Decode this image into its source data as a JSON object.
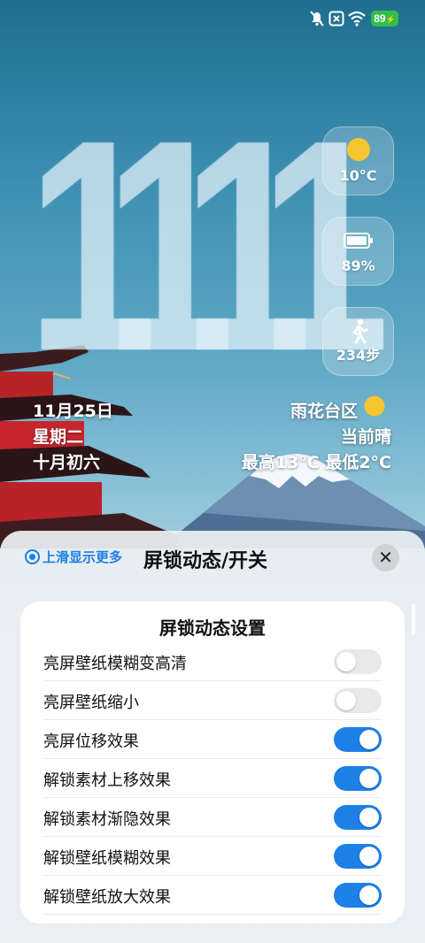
{
  "status_bar": {
    "battery_level": "89",
    "icons": [
      "mute-icon",
      "no-sim-icon",
      "wifi-icon",
      "battery-charging-icon"
    ]
  },
  "clock": {
    "time": "1111"
  },
  "widgets": {
    "weather": {
      "temp": "10°C",
      "icon": "sun-icon"
    },
    "battery": {
      "value": "89%",
      "icon": "battery-icon"
    },
    "steps": {
      "value": "234步",
      "icon": "walking-icon"
    }
  },
  "date_info": {
    "date": "11月25日",
    "weekday": "星期二",
    "lunar": "十月初六"
  },
  "weather_info": {
    "location": "雨花台区",
    "condition": "当前晴",
    "range": "最高13°C  最低2°C"
  },
  "panel": {
    "swipe_hint": "上滑显示更多",
    "title": "屏锁动态/开关",
    "card_title": "屏锁动态设置",
    "rows": [
      {
        "label": "亮屏壁纸模糊变高清",
        "on": false
      },
      {
        "label": "亮屏壁纸缩小",
        "on": false
      },
      {
        "label": "亮屏位移效果",
        "on": true
      },
      {
        "label": "解锁素材上移效果",
        "on": true
      },
      {
        "label": "解锁素材渐隐效果",
        "on": true
      },
      {
        "label": "解锁壁纸模糊效果",
        "on": true
      },
      {
        "label": "解锁壁纸放大效果",
        "on": true
      }
    ]
  },
  "colors": {
    "accent": "#1e7fe6",
    "battery_green": "#2fbf4a",
    "sun": "#f7c531"
  }
}
